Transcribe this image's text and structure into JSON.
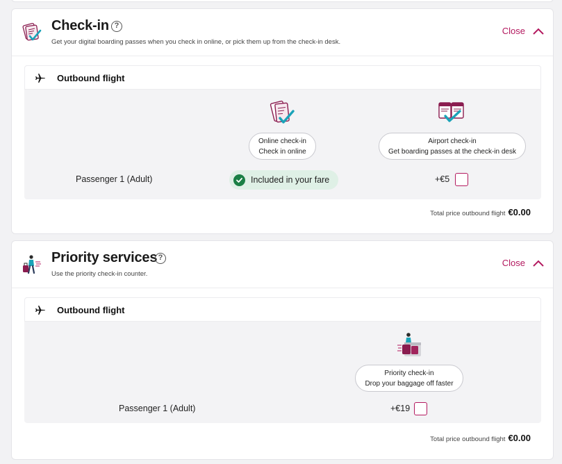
{
  "checkin": {
    "title": "Check-in",
    "help": "?",
    "subtitle": "Get your digital boarding passes when you check in online, or pick them up from the check-in desk.",
    "close_label": "Close",
    "flight_title": "Outbound flight",
    "options": [
      {
        "title": "Online check-in",
        "desc": "Check in online"
      },
      {
        "title": "Airport check-in",
        "desc": "Get boarding passes at the check-in desk"
      }
    ],
    "passenger": "Passenger 1 (Adult)",
    "included_label": "Included in your fare",
    "airport_price": "+€5",
    "total_label": "Total price outbound flight",
    "total_value": "€0.00"
  },
  "priority": {
    "title": "Priority services",
    "help": "?",
    "subtitle": "Use the priority check-in counter.",
    "close_label": "Close",
    "flight_title": "Outbound flight",
    "option": {
      "title": "Priority check-in",
      "desc": "Drop your baggage off faster"
    },
    "passenger": "Passenger 1 (Adult)",
    "price": "+€19",
    "total_label": "Total price outbound flight",
    "total_value": "€0.00"
  },
  "colors": {
    "accent": "#b3195f",
    "success": "#1a7f45",
    "success_bg": "#dff0e6",
    "icon_teal": "#1aa3b8"
  },
  "icons": [
    "checkin-pass-icon",
    "help-icon",
    "chevron-up-icon",
    "plane-icon",
    "online-checkin-icon",
    "airport-checkin-icon",
    "checkmark-icon",
    "priority-traveler-icon",
    "priority-checkin-icon"
  ]
}
